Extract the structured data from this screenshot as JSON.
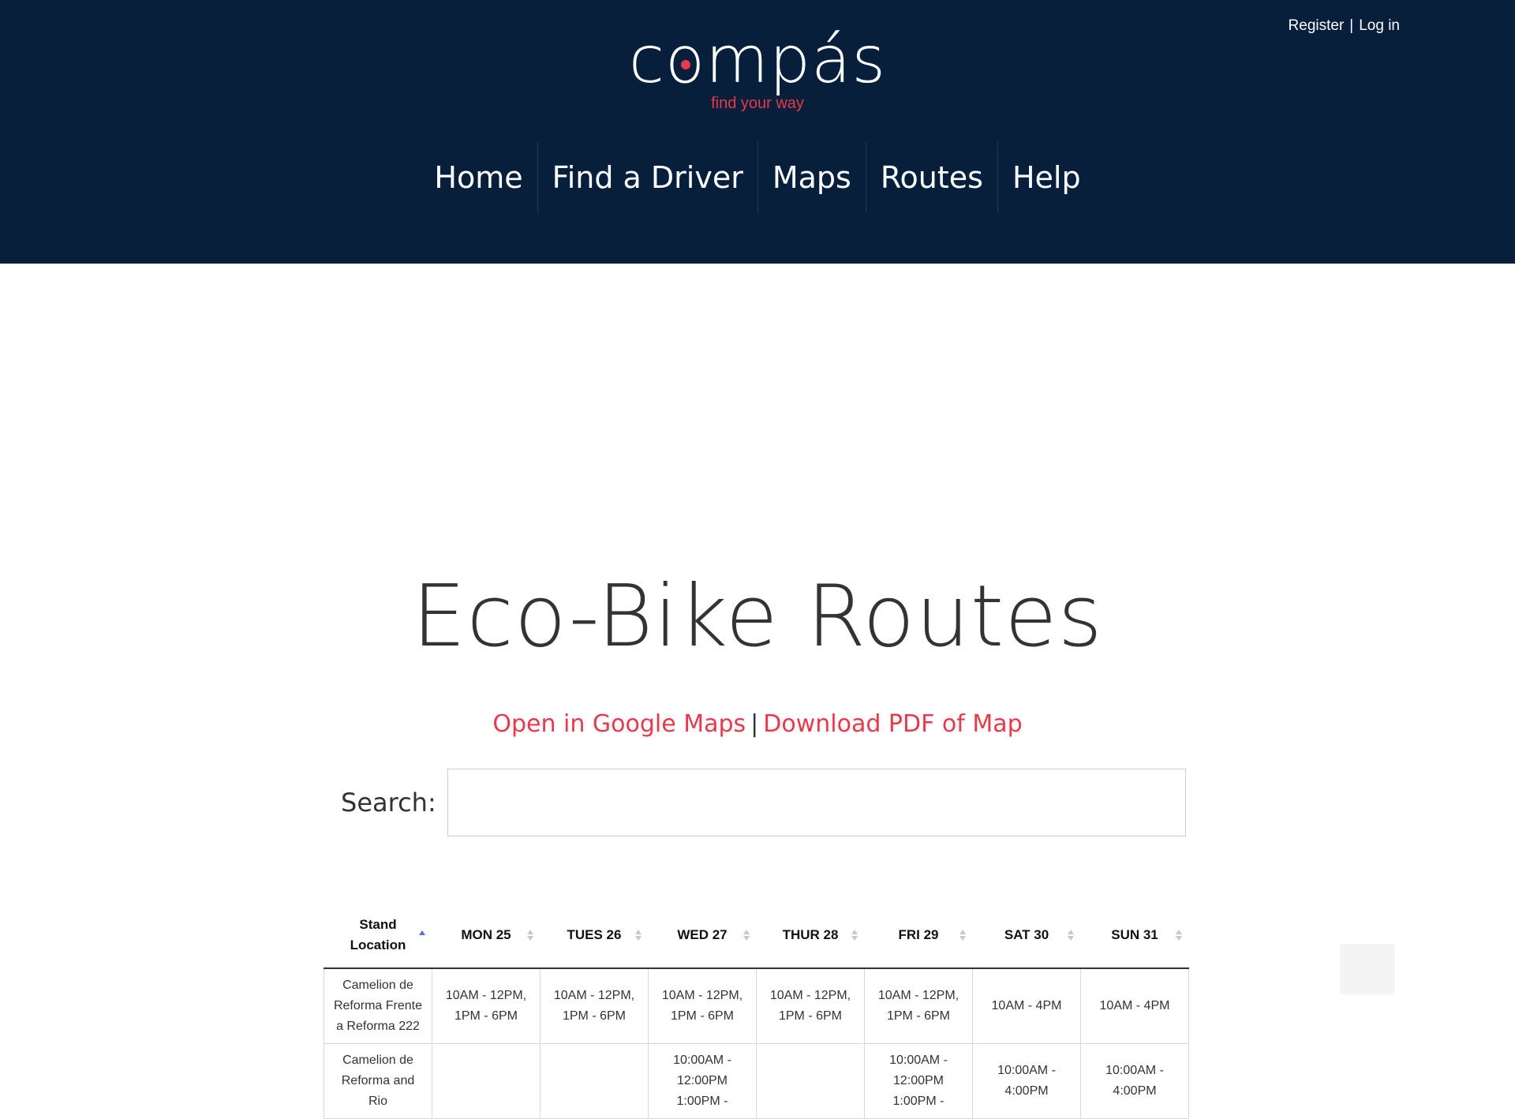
{
  "header": {
    "auth": {
      "register": "Register",
      "separator": "|",
      "login": "Log in"
    },
    "logo": {
      "prefix": "c",
      "o_letter": "o",
      "suffix": "mpás",
      "tagline": "find your way"
    },
    "nav": [
      "Home",
      "Find a Driver",
      "Maps",
      "Routes",
      "Help"
    ]
  },
  "main": {
    "title": "Eco-Bike Routes",
    "links": {
      "google_maps": "Open in Google Maps",
      "separator": "|",
      "pdf": "Download PDF of Map"
    },
    "search": {
      "label": "Search:",
      "placeholder": ""
    }
  },
  "table": {
    "headers": [
      "Stand Location",
      "MON 25",
      "TUES 26",
      "WED 27",
      "THUR 28",
      "FRI 29",
      "SAT 30",
      "SUN 31"
    ],
    "rows": [
      [
        "Camelion de Reforma Frente a Reforma 222",
        "10AM - 12PM, 1PM - 6PM",
        "10AM - 12PM, 1PM - 6PM",
        "10AM - 12PM, 1PM - 6PM",
        "10AM - 12PM, 1PM - 6PM",
        "10AM - 12PM, 1PM - 6PM",
        "10AM - 4PM",
        "10AM - 4PM"
      ],
      [
        "Camelion de Reforma and Rio",
        "",
        "",
        "10:00AM - 12:00PM 1:00PM -",
        "",
        "10:00AM - 12:00PM 1:00PM -",
        "10:00AM - 4:00PM",
        "10:00AM - 4:00PM"
      ]
    ]
  },
  "colors": {
    "header_bg": "#071f3b",
    "accent": "#e8394b",
    "sort_active": "#5b6fcf",
    "sort_inactive": "#c8c8c8"
  },
  "icons": {
    "sort_active": "sort-ascending-icon",
    "sort_inactive": "sort-icon",
    "logo_mark": "compass-needle-icon"
  }
}
